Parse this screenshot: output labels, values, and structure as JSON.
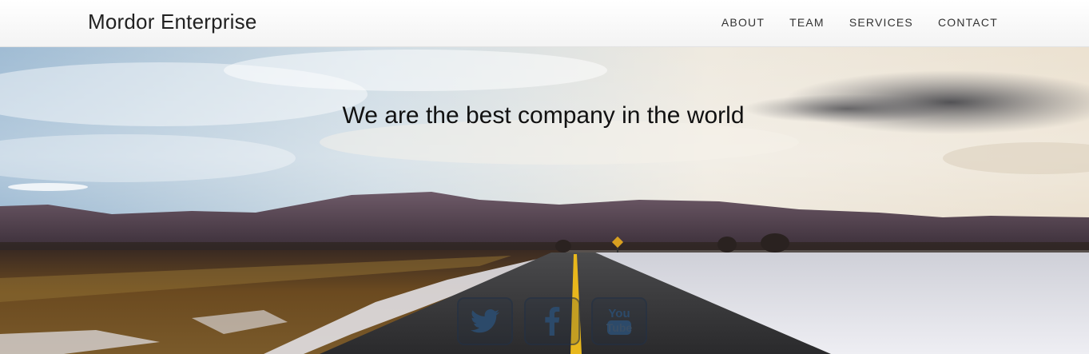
{
  "header": {
    "brand": "Mordor Enterprise",
    "nav": [
      {
        "label": "ABOUT"
      },
      {
        "label": "TEAM"
      },
      {
        "label": "SERVICES"
      },
      {
        "label": "CONTACT"
      }
    ]
  },
  "hero": {
    "headline": "We are the best company in the world",
    "social": [
      {
        "icon": "twitter-icon"
      },
      {
        "icon": "facebook-icon"
      },
      {
        "icon": "youtube-icon",
        "text_top": "You",
        "text_bottom": "Tube"
      }
    ],
    "colors": {
      "icon": "#2c4a6a",
      "road_line": "#e8b71c"
    }
  }
}
